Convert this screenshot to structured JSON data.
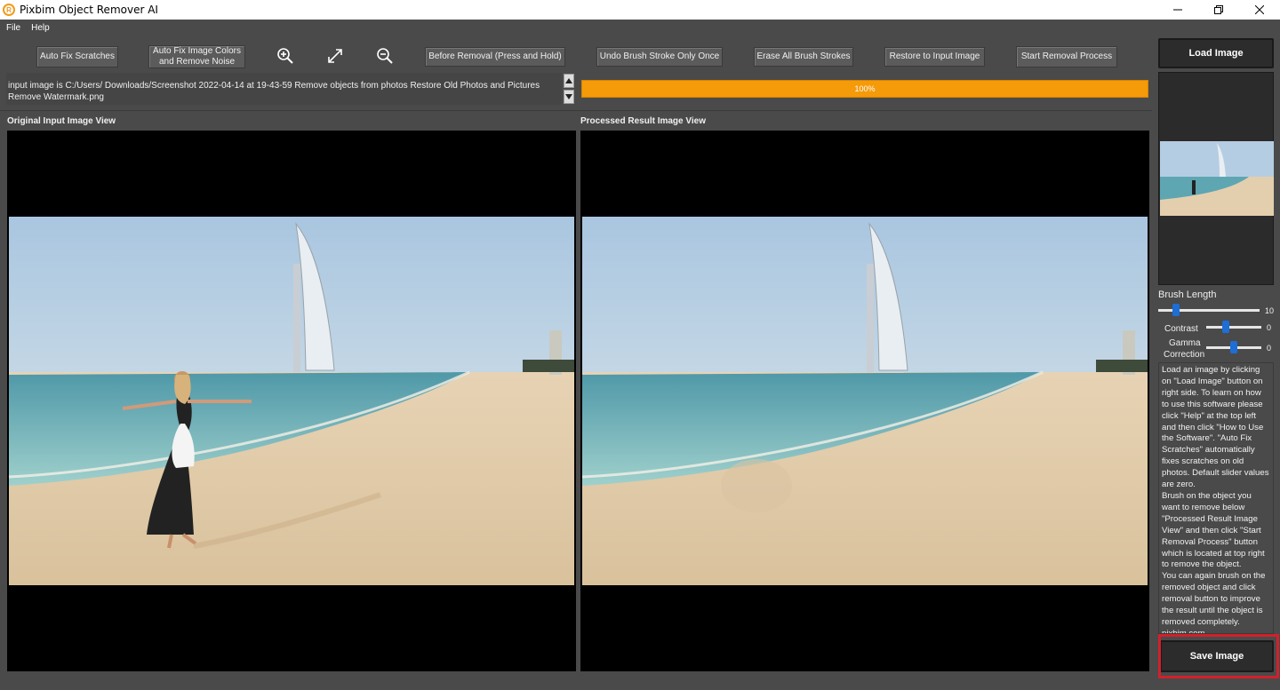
{
  "window": {
    "title": "Pixbim Object Remover AI"
  },
  "menu": {
    "file": "File",
    "help": "Help"
  },
  "toolbar": {
    "auto_fix_scratches": "Auto Fix Scratches",
    "auto_fix_colors_line1": "Auto Fix Image Colors",
    "auto_fix_colors_line2": "and Remove Noise",
    "zoom_in_icon": "zoom-in-icon",
    "fit_icon": "fullscreen-icon",
    "zoom_out_icon": "zoom-out-icon",
    "before_removal": "Before Removal (Press and Hold)",
    "undo_stroke": "Undo Brush Stroke Only Once",
    "erase_strokes": "Erase All Brush Strokes",
    "restore_input": "Restore to Input Image",
    "start_removal": "Start Removal Process"
  },
  "status": {
    "path_text": "input image is C:/Users/ Downloads/Screenshot 2022-04-14 at 19-43-59 Remove objects from photos Restore Old Photos and Pictures Remove Watermark.png",
    "progress_text": "100%",
    "progress_value": 1.0,
    "progress_color": "#f59a09"
  },
  "views": {
    "original_label": "Original Input Image View",
    "processed_label": "Processed Result Image View"
  },
  "right_panel": {
    "load_image": "Load Image",
    "save_image": "Save Image",
    "brush_length_label": "Brush Length",
    "brush_length_value": "10",
    "contrast_label": "Contrast",
    "contrast_value": "0",
    "gamma_label_1": "Gamma",
    "gamma_label_2": "Correction",
    "gamma_value": "0",
    "help_text": "Load an image by clicking on \"Load Image\" button on right side. To learn on how to use this software please click \"Help\" at the top left and then click \"How to Use the Software\". \"Auto Fix Scratches\" automatically fixes scratches on old photos. Default slider values are zero.\nBrush on the object you want to remove below \"Processed Result Image View\" and then click \"Start Removal Process\" button which is located at top right to remove the object.\n You can again brush on the removed object and click removal button to improve the result until the object is removed completely.\npixbim.com"
  },
  "colors": {
    "accent": "#f59a09",
    "slider_thumb": "#1e6ed6",
    "highlight": "#d2202a"
  }
}
